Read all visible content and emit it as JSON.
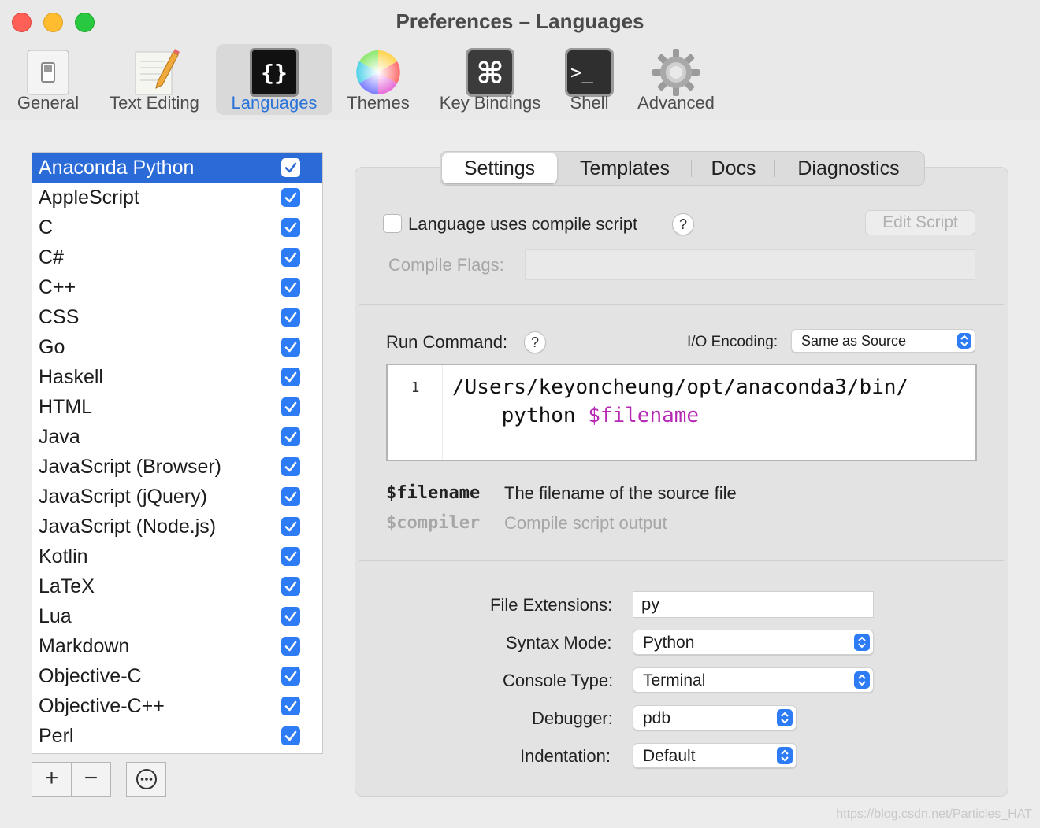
{
  "window": {
    "title": "Preferences – Languages"
  },
  "toolbar": [
    {
      "label": "General",
      "icon": "switch-icon"
    },
    {
      "label": "Text Editing",
      "icon": "pencil-notepad-icon"
    },
    {
      "label": "Languages",
      "icon": "braces-icon",
      "glyph": "{}",
      "selected": true
    },
    {
      "label": "Themes",
      "icon": "color-wheel-icon"
    },
    {
      "label": "Key Bindings",
      "icon": "command-key-icon",
      "glyph": "⌘"
    },
    {
      "label": "Shell",
      "icon": "terminal-icon",
      "glyph": ">_"
    },
    {
      "label": "Advanced",
      "icon": "gear-icon"
    }
  ],
  "languages": [
    {
      "name": "Anaconda Python",
      "checked": true,
      "selected": true
    },
    {
      "name": "AppleScript",
      "checked": true
    },
    {
      "name": "C",
      "checked": true
    },
    {
      "name": "C#",
      "checked": true
    },
    {
      "name": "C++",
      "checked": true
    },
    {
      "name": "CSS",
      "checked": true
    },
    {
      "name": "Go",
      "checked": true
    },
    {
      "name": "Haskell",
      "checked": true
    },
    {
      "name": "HTML",
      "checked": true
    },
    {
      "name": "Java",
      "checked": true
    },
    {
      "name": "JavaScript (Browser)",
      "checked": true
    },
    {
      "name": "JavaScript (jQuery)",
      "checked": true
    },
    {
      "name": "JavaScript (Node.js)",
      "checked": true
    },
    {
      "name": "Kotlin",
      "checked": true
    },
    {
      "name": "LaTeX",
      "checked": true
    },
    {
      "name": "Lua",
      "checked": true
    },
    {
      "name": "Markdown",
      "checked": true
    },
    {
      "name": "Objective-C",
      "checked": true
    },
    {
      "name": "Objective-C++",
      "checked": true
    },
    {
      "name": "Perl",
      "checked": true
    }
  ],
  "list_buttons": {
    "add": "+",
    "remove": "−",
    "more": "⋯"
  },
  "tabs": {
    "settings": "Settings",
    "templates": "Templates",
    "docs": "Docs",
    "diagnostics": "Diagnostics",
    "selected": "Settings"
  },
  "compile": {
    "uses_compile_label": "Language uses compile script",
    "checked": false,
    "help": "?",
    "edit_script": "Edit Script",
    "flags_label": "Compile Flags:",
    "flags_value": ""
  },
  "run": {
    "label": "Run Command:",
    "help": "?",
    "encoding_label": "I/O Encoding:",
    "encoding_value": "Same as Source",
    "line_number": "1",
    "command_line1": "/Users/keyoncheung/opt/anaconda3/bin/",
    "command_line2_plain": "    python ",
    "command_line2_var": "$filename"
  },
  "variables": [
    {
      "name": "$filename",
      "desc": "The filename of the source file",
      "enabled": true
    },
    {
      "name": "$compiler",
      "desc": "Compile script output",
      "enabled": false
    }
  ],
  "fields": {
    "extensions_label": "File Extensions:",
    "extensions_value": "py",
    "syntax_label": "Syntax Mode:",
    "syntax_value": "Python",
    "console_label": "Console Type:",
    "console_value": "Terminal",
    "debugger_label": "Debugger:",
    "debugger_value": "pdb",
    "indent_label": "Indentation:",
    "indent_value": "Default"
  },
  "watermark": "https://blog.csdn.net/Particles_HAT",
  "colors": {
    "accent": "#2d7cf6",
    "selection": "#2b6bd8",
    "variable": "#b428b4"
  }
}
